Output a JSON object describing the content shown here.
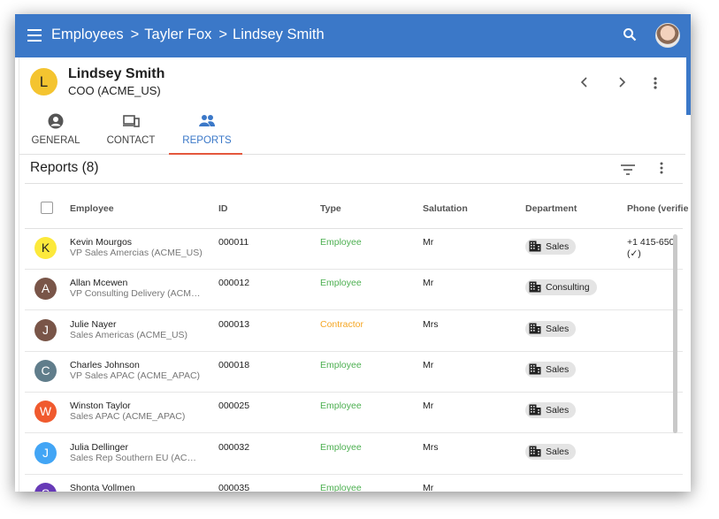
{
  "breadcrumb": [
    "Employees",
    "Tayler Fox",
    "Lindsey Smith"
  ],
  "breadcrumb_sep": ">",
  "icons": {
    "menu": "menu-icon",
    "search": "search-icon",
    "prev": "chevron-left-icon",
    "next": "chevron-right-icon",
    "more": "more-vert-icon",
    "filter": "filter-list-icon",
    "department": "building-icon"
  },
  "person": {
    "initial": "L",
    "name": "Lindsey Smith",
    "role": "COO (ACME_US)"
  },
  "tabs": [
    {
      "label": "GENERAL",
      "icon": "person-icon"
    },
    {
      "label": "CONTACT",
      "icon": "devices-icon"
    },
    {
      "label": "REPORTS",
      "icon": "people-icon"
    }
  ],
  "reports_title": "Reports (8)",
  "columns": {
    "employee": "Employee",
    "id": "ID",
    "type": "Type",
    "salutation": "Salutation",
    "department": "Department",
    "phone": "Phone (verifie"
  },
  "colors": {
    "appbar": "#3b78c8",
    "employee_type": "#4caf50",
    "contractor_type": "#f5a623",
    "tab_underline": "#e4573d"
  },
  "rows": [
    {
      "initial": "K",
      "avatar_color": "#fce93b",
      "avatar_text_color": "#222",
      "name": "Kevin Mourgos",
      "title": "VP Sales Amercias (ACME_US)",
      "id": "000011",
      "type": "Employee",
      "type_color": "#4caf50",
      "salutation": "Mr",
      "department": "Sales",
      "phone": "+1 415-650",
      "phone2": "(✓)"
    },
    {
      "initial": "A",
      "avatar_color": "#795548",
      "avatar_text_color": "#fff",
      "name": "Allan Mcewen",
      "title": "VP Consulting Delivery (ACME_US)",
      "id": "000012",
      "type": "Employee",
      "type_color": "#4caf50",
      "salutation": "Mr",
      "department": "Consulting",
      "phone": "",
      "phone2": ""
    },
    {
      "initial": "J",
      "avatar_color": "#795548",
      "avatar_text_color": "#fff",
      "name": "Julie Nayer",
      "title": "Sales Americas (ACME_US)",
      "id": "000013",
      "type": "Contractor",
      "type_color": "#f5a623",
      "salutation": "Mrs",
      "department": "Sales",
      "phone": "",
      "phone2": ""
    },
    {
      "initial": "C",
      "avatar_color": "#607d8b",
      "avatar_text_color": "#fff",
      "name": "Charles Johnson",
      "title": "VP Sales APAC (ACME_APAC)",
      "id": "000018",
      "type": "Employee",
      "type_color": "#4caf50",
      "salutation": "Mr",
      "department": "Sales",
      "phone": "",
      "phone2": ""
    },
    {
      "initial": "W",
      "avatar_color": "#f05a2e",
      "avatar_text_color": "#fff",
      "name": "Winston Taylor",
      "title": "Sales APAC (ACME_APAC)",
      "id": "000025",
      "type": "Employee",
      "type_color": "#4caf50",
      "salutation": "Mr",
      "department": "Sales",
      "phone": "",
      "phone2": ""
    },
    {
      "initial": "J",
      "avatar_color": "#42a5f5",
      "avatar_text_color": "#fff",
      "name": "Julia Dellinger",
      "title": "Sales Rep Southern EU (ACME_EU)",
      "id": "000032",
      "type": "Employee",
      "type_color": "#4caf50",
      "salutation": "Mrs",
      "department": "Sales",
      "phone": "",
      "phone2": ""
    },
    {
      "initial": "S",
      "avatar_color": "#673ab7",
      "avatar_text_color": "#fff",
      "name": "Shonta Vollmen",
      "title": "",
      "id": "000035",
      "type": "Employee",
      "type_color": "#4caf50",
      "salutation": "Mr",
      "department": "",
      "phone": "",
      "phone2": ""
    }
  ]
}
